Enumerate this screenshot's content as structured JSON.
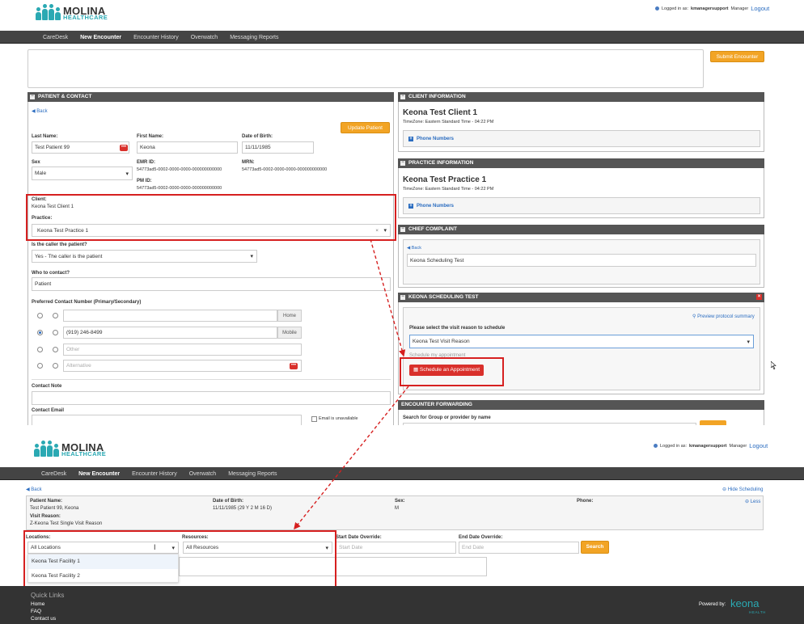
{
  "header": {
    "logo_main": "MOLINA",
    "logo_sub": "HEALTHCARE",
    "logged_in_as_label": "Logged in as:",
    "username": "kmanagersupport",
    "role": "Manager",
    "logout": "Logout"
  },
  "nav": {
    "items": [
      "CareDesk",
      "New Encounter",
      "Encounter History",
      "Overwatch",
      "Messaging Reports"
    ],
    "active": "New Encounter"
  },
  "encounter": {
    "submit_label": "Submit Encounter"
  },
  "patient_contact": {
    "title": "PATIENT & CONTACT",
    "back": "Back",
    "update_btn": "Update Patient",
    "last_name_label": "Last Name:",
    "last_name": "Test Patient 99",
    "first_name_label": "First Name:",
    "first_name": "Keona",
    "dob_label": "Date of Birth:",
    "dob": "11/11/1985",
    "sex_label": "Sex",
    "sex": "Male",
    "emr_label": "EMR ID:",
    "emr_id": "54773ad5-0002-0000-0000-000000000000",
    "mrn_label": "MRN:",
    "mrn": "54773ad5-0002-0000-0000-000000000000",
    "pm_label": "PM ID:",
    "pm_id": "54773ad5-0002-0000-0000-000000000000",
    "client_label": "Client:",
    "client": "Keona Test Client 1",
    "practice_label": "Practice:",
    "practice": "Keona Test Practice 1",
    "caller_label": "Is the caller the patient?",
    "caller": "Yes - The caller is the patient",
    "who_label": "Who to contact?",
    "who": "Patient",
    "pref_label": "Preferred Contact Number (Primary/Secondary)",
    "phones": [
      {
        "value": "",
        "placeholder": "",
        "tag": "Home"
      },
      {
        "value": "(919) 246-8499",
        "placeholder": "",
        "tag": "Mobile"
      },
      {
        "value": "",
        "placeholder": "Other",
        "tag": ""
      },
      {
        "value": "",
        "placeholder": "Alternative",
        "tag": ""
      }
    ],
    "contact_note_label": "Contact Note",
    "contact_email_label": "Contact Email",
    "email_unavailable": "Email is unavailable"
  },
  "client_info": {
    "title": "CLIENT INFORMATION",
    "name": "Keona Test Client 1",
    "tz": "TimeZone: Eastern Standard Time - 04:22 PM",
    "phone_numbers": "Phone Numbers"
  },
  "practice_info": {
    "title": "PRACTICE INFORMATION",
    "name": "Keona Test Practice 1",
    "tz": "TimeZone: Eastern Standard Time - 04:22 PM",
    "phone_numbers": "Phone Numbers"
  },
  "chief_complaint": {
    "title": "CHIEF COMPLAINT",
    "back": "Back",
    "value": "Keona Scheduling Test"
  },
  "scheduling_test": {
    "title": "KEONA SCHEDULING TEST",
    "preview": "Preview protocol summary",
    "select_label": "Please select the visit reason to schedule",
    "select_value": "Keona Test Visit Reason",
    "hidden_text": "Schedule my appointment",
    "schedule_btn": "Schedule an Appointment"
  },
  "forwarding": {
    "title": "ENCOUNTER FORWARDING",
    "search_label": "Search for Group or provider by name"
  },
  "scheduling_view": {
    "back": "Back",
    "hide": "Hide Scheduling",
    "patient_name_label": "Patient Name:",
    "patient_name": "Test Patient 99, Keona",
    "dob_label": "Date of Birth:",
    "dob": "11/11/1985 (29 Y 2 M 16 D)",
    "sex_label": "Sex:",
    "sex": "M",
    "phone_label": "Phone:",
    "less": "Less",
    "visit_reason_label": "Visit Reason:",
    "visit_reason": "Z-Keona Test Single Visit Reason",
    "locations_label": "Locations:",
    "locations_value": "All Locations",
    "resources_label": "Resources:",
    "resources_value": "All Resources",
    "start_label": "Start Date Override:",
    "start_placeholder": "Start Date",
    "end_label": "End Date Override:",
    "end_placeholder": "End Date",
    "search_btn": "Search",
    "options": [
      "Keona Test Facility 1",
      "Keona Test Facility 2"
    ]
  },
  "footer": {
    "quick_links": "Quick Links",
    "links": [
      "Home",
      "FAQ",
      "Contact us"
    ],
    "powered_by": "Powered by:",
    "brand": "keona",
    "brand_sub": "HEALTH"
  },
  "colors": {
    "accent_orange": "#f2a425",
    "highlight_red": "#d62020",
    "nav_bg": "#444444",
    "brand_teal": "#2aa9b3"
  }
}
